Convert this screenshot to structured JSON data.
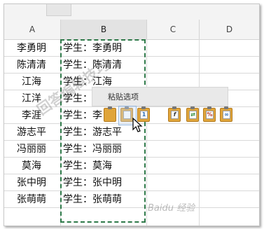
{
  "columns": [
    "A",
    "B",
    "C",
    "D"
  ],
  "rows": [
    {
      "a": "李勇明",
      "b": "学生：李勇明"
    },
    {
      "a": "陈清清",
      "b": "学生：陈清清"
    },
    {
      "a": "江海",
      "b": "学生：江海"
    },
    {
      "a": "江洋",
      "b": "学生：江"
    },
    {
      "a": "李涯",
      "b": "学生：李"
    },
    {
      "a": "游志平",
      "b": "学生：游志平"
    },
    {
      "a": "冯丽丽",
      "b": "学生：冯丽丽"
    },
    {
      "a": "莫海",
      "b": "学生：莫海"
    },
    {
      "a": "张中明",
      "b": "学生：张中明"
    },
    {
      "a": "张萌萌",
      "b": "学生：张萌萌"
    }
  ],
  "paste_options": {
    "title": "粘贴选项",
    "icons": [
      "paste-icon",
      "paste-formulas-icon",
      "paste-values-icon",
      "paste-formula-fx-icon",
      "paste-transpose-icon",
      "paste-formatting-icon",
      "paste-link-icon"
    ]
  },
  "watermark": {
    "left": "回答编辑技巧",
    "right": "Baidu 经验"
  },
  "colors": {
    "marquee": "#2f7a4a",
    "clipboard": "#e0a53a",
    "header_bg": "#f4f4f4"
  }
}
